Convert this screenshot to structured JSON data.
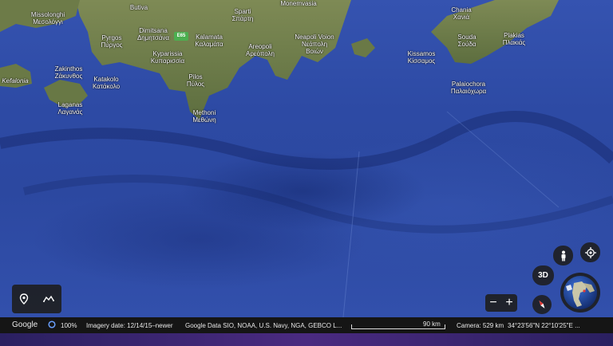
{
  "map_labels": {
    "missolonghi": [
      "Missolonghi",
      "Μεσολόγγι"
    ],
    "butiva": [
      "Butiva"
    ],
    "sparti": [
      "Sparti",
      "Σπάρτη"
    ],
    "monemvasia": [
      "Monemvasia"
    ],
    "chania": [
      "Chania",
      "Χανιά"
    ],
    "pyrgos": [
      "Pyrgos",
      "Πύργος"
    ],
    "dimitsana": [
      "Dimitsana",
      "Δημητσάνα"
    ],
    "kalamata": [
      "Kalamata",
      "Καλαμάτα"
    ],
    "neapoli": [
      "Neapoli Voion",
      "Νεάπολη",
      "Βοιών"
    ],
    "souda": [
      "Souda",
      "Σούδα"
    ],
    "plakias": [
      "Plakias",
      "Πλακιάς"
    ],
    "kyparissia": [
      "Kyparissia",
      "Κυπαρισσία"
    ],
    "areopoli": [
      "Areopoli",
      "Αρεόπολη"
    ],
    "kissamos": [
      "Kissamos",
      "Κίσσαμος"
    ],
    "zakinthos": [
      "Zakinthos",
      "Ζάκυνθος"
    ],
    "katakolo": [
      "Katakolo",
      "Κατάκολο"
    ],
    "kefalonia": [
      "Kefalonia"
    ],
    "pilos": [
      "Pilos",
      "Πύλος"
    ],
    "palaiochora": [
      "Palaiochora",
      "Παλαιόχωρα"
    ],
    "laganas": [
      "Laganas",
      "Λαγανάς"
    ],
    "methoni": [
      "Methoni",
      "Μεθώνη"
    ]
  },
  "road_shield": "E65",
  "controls": {
    "three_d": "3D",
    "zoom_out": "−",
    "zoom_in": "+"
  },
  "status": {
    "brand": "Google",
    "percent": "100%",
    "imagery_date": "Imagery date: 12/14/15–newer",
    "data_sources": "Google  Data SIO, NOAA, U.S. Navy, NGA, GEBCO  L...",
    "scale": "90 km",
    "camera": "Camera: 529 km",
    "coords": "34°23'56\"N 22°10'25\"E ..."
  },
  "icons": {
    "place": "place-marker-icon",
    "path": "path-icon",
    "person": "pegman-icon",
    "location": "my-location-icon",
    "compass": "compass-icon",
    "globe": "globe-icon",
    "loading": "loading-ring-icon"
  },
  "colors": {
    "sea": "#2d4aa4",
    "land": "#6b7a4a",
    "status_bar": "#151515"
  }
}
